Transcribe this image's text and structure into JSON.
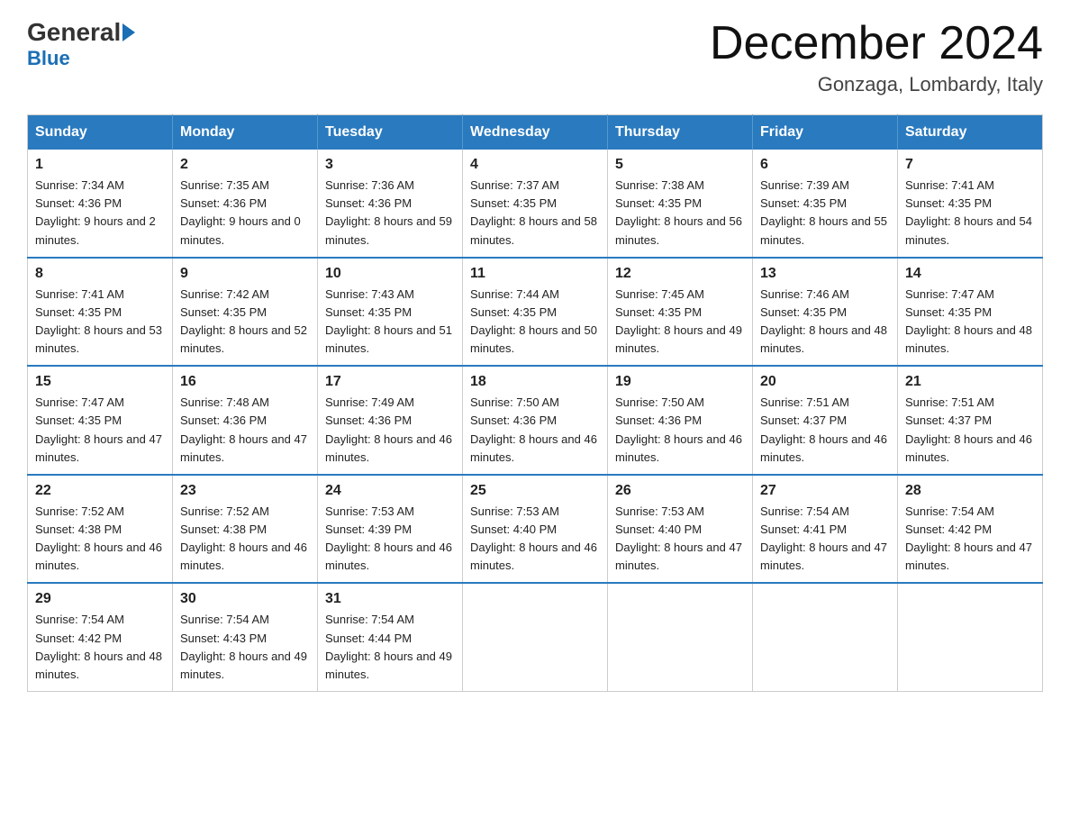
{
  "header": {
    "logo_general": "General",
    "logo_blue": "Blue",
    "month_title": "December 2024",
    "subtitle": "Gonzaga, Lombardy, Italy"
  },
  "weekdays": [
    "Sunday",
    "Monday",
    "Tuesday",
    "Wednesday",
    "Thursday",
    "Friday",
    "Saturday"
  ],
  "weeks": [
    [
      {
        "day": "1",
        "sunrise": "Sunrise: 7:34 AM",
        "sunset": "Sunset: 4:36 PM",
        "daylight": "Daylight: 9 hours and 2 minutes."
      },
      {
        "day": "2",
        "sunrise": "Sunrise: 7:35 AM",
        "sunset": "Sunset: 4:36 PM",
        "daylight": "Daylight: 9 hours and 0 minutes."
      },
      {
        "day": "3",
        "sunrise": "Sunrise: 7:36 AM",
        "sunset": "Sunset: 4:36 PM",
        "daylight": "Daylight: 8 hours and 59 minutes."
      },
      {
        "day": "4",
        "sunrise": "Sunrise: 7:37 AM",
        "sunset": "Sunset: 4:35 PM",
        "daylight": "Daylight: 8 hours and 58 minutes."
      },
      {
        "day": "5",
        "sunrise": "Sunrise: 7:38 AM",
        "sunset": "Sunset: 4:35 PM",
        "daylight": "Daylight: 8 hours and 56 minutes."
      },
      {
        "day": "6",
        "sunrise": "Sunrise: 7:39 AM",
        "sunset": "Sunset: 4:35 PM",
        "daylight": "Daylight: 8 hours and 55 minutes."
      },
      {
        "day": "7",
        "sunrise": "Sunrise: 7:41 AM",
        "sunset": "Sunset: 4:35 PM",
        "daylight": "Daylight: 8 hours and 54 minutes."
      }
    ],
    [
      {
        "day": "8",
        "sunrise": "Sunrise: 7:41 AM",
        "sunset": "Sunset: 4:35 PM",
        "daylight": "Daylight: 8 hours and 53 minutes."
      },
      {
        "day": "9",
        "sunrise": "Sunrise: 7:42 AM",
        "sunset": "Sunset: 4:35 PM",
        "daylight": "Daylight: 8 hours and 52 minutes."
      },
      {
        "day": "10",
        "sunrise": "Sunrise: 7:43 AM",
        "sunset": "Sunset: 4:35 PM",
        "daylight": "Daylight: 8 hours and 51 minutes."
      },
      {
        "day": "11",
        "sunrise": "Sunrise: 7:44 AM",
        "sunset": "Sunset: 4:35 PM",
        "daylight": "Daylight: 8 hours and 50 minutes."
      },
      {
        "day": "12",
        "sunrise": "Sunrise: 7:45 AM",
        "sunset": "Sunset: 4:35 PM",
        "daylight": "Daylight: 8 hours and 49 minutes."
      },
      {
        "day": "13",
        "sunrise": "Sunrise: 7:46 AM",
        "sunset": "Sunset: 4:35 PM",
        "daylight": "Daylight: 8 hours and 48 minutes."
      },
      {
        "day": "14",
        "sunrise": "Sunrise: 7:47 AM",
        "sunset": "Sunset: 4:35 PM",
        "daylight": "Daylight: 8 hours and 48 minutes."
      }
    ],
    [
      {
        "day": "15",
        "sunrise": "Sunrise: 7:47 AM",
        "sunset": "Sunset: 4:35 PM",
        "daylight": "Daylight: 8 hours and 47 minutes."
      },
      {
        "day": "16",
        "sunrise": "Sunrise: 7:48 AM",
        "sunset": "Sunset: 4:36 PM",
        "daylight": "Daylight: 8 hours and 47 minutes."
      },
      {
        "day": "17",
        "sunrise": "Sunrise: 7:49 AM",
        "sunset": "Sunset: 4:36 PM",
        "daylight": "Daylight: 8 hours and 46 minutes."
      },
      {
        "day": "18",
        "sunrise": "Sunrise: 7:50 AM",
        "sunset": "Sunset: 4:36 PM",
        "daylight": "Daylight: 8 hours and 46 minutes."
      },
      {
        "day": "19",
        "sunrise": "Sunrise: 7:50 AM",
        "sunset": "Sunset: 4:36 PM",
        "daylight": "Daylight: 8 hours and 46 minutes."
      },
      {
        "day": "20",
        "sunrise": "Sunrise: 7:51 AM",
        "sunset": "Sunset: 4:37 PM",
        "daylight": "Daylight: 8 hours and 46 minutes."
      },
      {
        "day": "21",
        "sunrise": "Sunrise: 7:51 AM",
        "sunset": "Sunset: 4:37 PM",
        "daylight": "Daylight: 8 hours and 46 minutes."
      }
    ],
    [
      {
        "day": "22",
        "sunrise": "Sunrise: 7:52 AM",
        "sunset": "Sunset: 4:38 PM",
        "daylight": "Daylight: 8 hours and 46 minutes."
      },
      {
        "day": "23",
        "sunrise": "Sunrise: 7:52 AM",
        "sunset": "Sunset: 4:38 PM",
        "daylight": "Daylight: 8 hours and 46 minutes."
      },
      {
        "day": "24",
        "sunrise": "Sunrise: 7:53 AM",
        "sunset": "Sunset: 4:39 PM",
        "daylight": "Daylight: 8 hours and 46 minutes."
      },
      {
        "day": "25",
        "sunrise": "Sunrise: 7:53 AM",
        "sunset": "Sunset: 4:40 PM",
        "daylight": "Daylight: 8 hours and 46 minutes."
      },
      {
        "day": "26",
        "sunrise": "Sunrise: 7:53 AM",
        "sunset": "Sunset: 4:40 PM",
        "daylight": "Daylight: 8 hours and 47 minutes."
      },
      {
        "day": "27",
        "sunrise": "Sunrise: 7:54 AM",
        "sunset": "Sunset: 4:41 PM",
        "daylight": "Daylight: 8 hours and 47 minutes."
      },
      {
        "day": "28",
        "sunrise": "Sunrise: 7:54 AM",
        "sunset": "Sunset: 4:42 PM",
        "daylight": "Daylight: 8 hours and 47 minutes."
      }
    ],
    [
      {
        "day": "29",
        "sunrise": "Sunrise: 7:54 AM",
        "sunset": "Sunset: 4:42 PM",
        "daylight": "Daylight: 8 hours and 48 minutes."
      },
      {
        "day": "30",
        "sunrise": "Sunrise: 7:54 AM",
        "sunset": "Sunset: 4:43 PM",
        "daylight": "Daylight: 8 hours and 49 minutes."
      },
      {
        "day": "31",
        "sunrise": "Sunrise: 7:54 AM",
        "sunset": "Sunset: 4:44 PM",
        "daylight": "Daylight: 8 hours and 49 minutes."
      },
      null,
      null,
      null,
      null
    ]
  ]
}
